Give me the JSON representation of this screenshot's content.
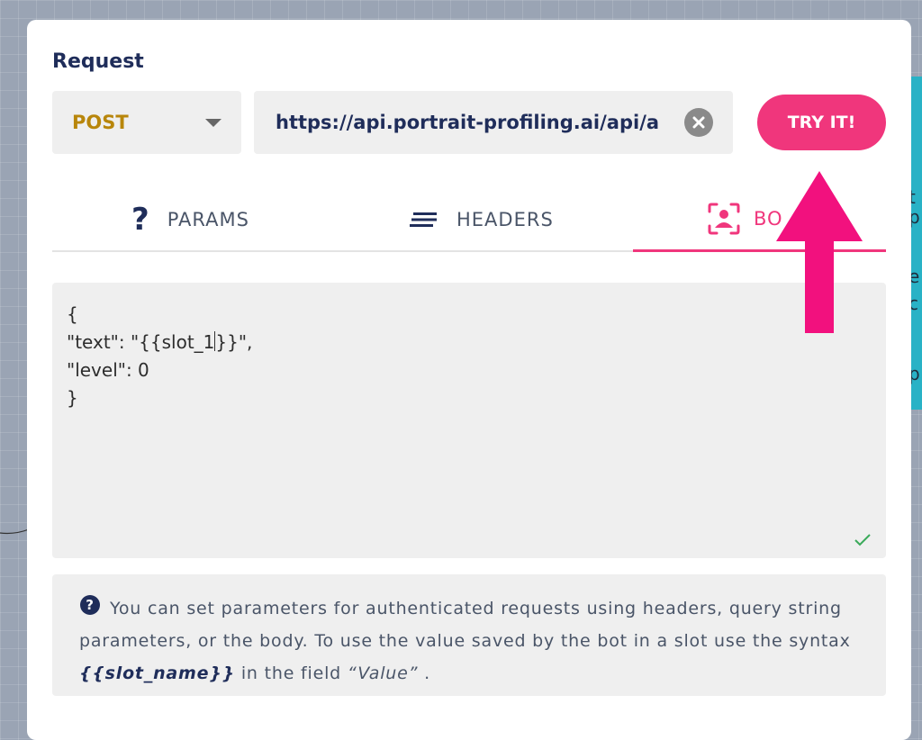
{
  "modal": {
    "title": "Request"
  },
  "request": {
    "method": "POST",
    "url": "https://api.portrait-profiling.ai/api/a",
    "try_label": "TRY IT!"
  },
  "tabs": [
    {
      "label": "PARAMS",
      "icon": "question-icon"
    },
    {
      "label": "HEADERS",
      "icon": "lines-icon"
    },
    {
      "label": "BODY",
      "icon": "user-frame-icon",
      "visible_text": "BO",
      "active": true
    }
  ],
  "body_editor": {
    "lines": [
      "{",
      "\"text\": \"{{slot_1",
      "}}\",",
      "\"level\": 0",
      "}"
    ]
  },
  "info": {
    "text_1": "You can set parameters for authenticated requests using headers, query string parameters, or the body. To use the value saved by the bot in a slot use the syntax ",
    "code": "{{slot_name}}",
    "text_2": " in the field ",
    "value": "“Value”",
    "text_3": " ."
  },
  "colors": {
    "accent": "#f0367c",
    "method": "#b8860b",
    "navy": "#1f2d5a",
    "side_panel": "#29b2c6"
  },
  "background_fragments": [
    "t",
    "p",
    "e",
    "c",
    "p"
  ]
}
